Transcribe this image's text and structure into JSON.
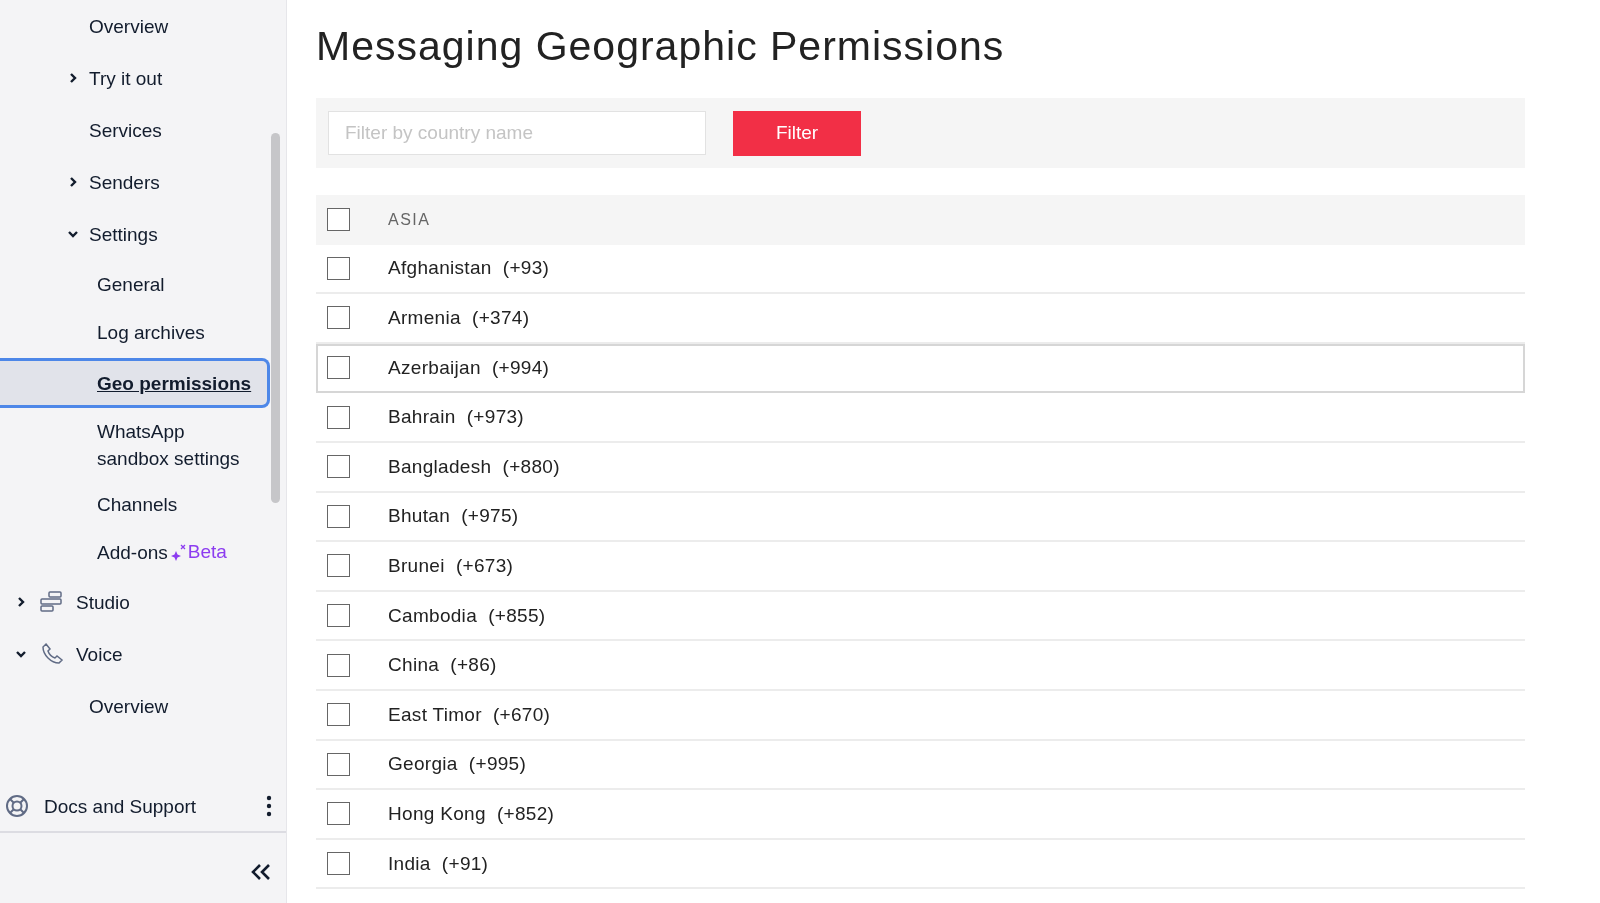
{
  "sidebar": {
    "items": [
      {
        "label": "Overview",
        "selected": false
      },
      {
        "label": "Try it out",
        "expanded": false,
        "selected": false
      },
      {
        "label": "Services",
        "selected": false
      },
      {
        "label": "Senders",
        "expanded": false,
        "selected": false
      },
      {
        "label": "Settings",
        "expanded": true,
        "selected": false,
        "children": [
          {
            "label": "General",
            "selected": false
          },
          {
            "label": "Log archives",
            "selected": false
          },
          {
            "label": "Geo permissions",
            "selected": true
          },
          {
            "label": "WhatsApp sandbox settings",
            "selected": false
          },
          {
            "label": "Channels",
            "selected": false
          },
          {
            "label": "Add-ons",
            "badge": "Beta",
            "selected": false
          }
        ]
      }
    ],
    "products": [
      {
        "label": "Studio",
        "kind": "studio",
        "expanded": false
      },
      {
        "label": "Voice",
        "kind": "voice",
        "expanded": true,
        "children": [
          {
            "label": "Overview",
            "selected": false
          }
        ]
      }
    ],
    "footer": {
      "label": "Docs and Support"
    }
  },
  "title": "Messaging Geographic Permissions",
  "filter": {
    "placeholder": "Filter by country name",
    "button": "Filter"
  },
  "region": {
    "label": "ASIA",
    "checked": false
  },
  "rows": [
    {
      "label": "Afghanistan  (+93)",
      "checked": false,
      "focused": false
    },
    {
      "label": "Armenia  (+374)",
      "checked": false,
      "focused": false
    },
    {
      "label": "Azerbaijan  (+994)",
      "checked": false,
      "focused": true
    },
    {
      "label": "Bahrain  (+973)",
      "checked": false,
      "focused": false
    },
    {
      "label": "Bangladesh  (+880)",
      "checked": false,
      "focused": false
    },
    {
      "label": "Bhutan  (+975)",
      "checked": false,
      "focused": false
    },
    {
      "label": "Brunei  (+673)",
      "checked": false,
      "focused": false
    },
    {
      "label": "Cambodia  (+855)",
      "checked": false,
      "focused": false
    },
    {
      "label": "China  (+86)",
      "checked": false,
      "focused": false
    },
    {
      "label": "East Timor  (+670)",
      "checked": false,
      "focused": false
    },
    {
      "label": "Georgia  (+995)",
      "checked": false,
      "focused": false
    },
    {
      "label": "Hong Kong  (+852)",
      "checked": false,
      "focused": false
    },
    {
      "label": "India  (+91)",
      "checked": false,
      "focused": false
    }
  ]
}
